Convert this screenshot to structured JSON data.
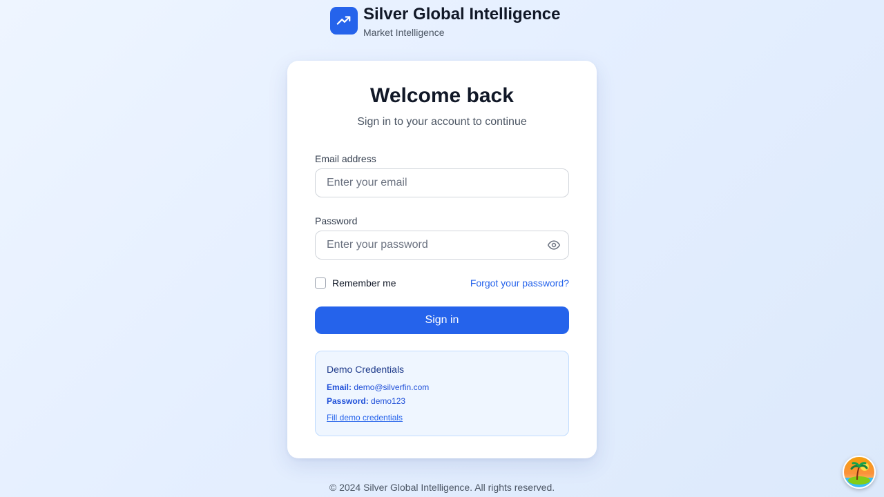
{
  "brand": {
    "title": "Silver Global Intelligence",
    "subtitle": "Market Intelligence",
    "logo_icon": "trending-up-icon",
    "logo_color": "#2563eb"
  },
  "login": {
    "heading": "Welcome back",
    "subheading": "Sign in to your account to continue",
    "email_label": "Email address",
    "email_placeholder": "Enter your email",
    "email_value": "",
    "password_label": "Password",
    "password_placeholder": "Enter your password",
    "password_value": "",
    "password_toggle_icon": "eye-icon",
    "remember_label": "Remember me",
    "remember_checked": false,
    "forgot_link": "Forgot your password?",
    "submit_label": "Sign in",
    "accent_color": "#2563eb"
  },
  "demo": {
    "title": "Demo Credentials",
    "email_key": "Email:",
    "email_value": "demo@silverfin.com",
    "password_key": "Password:",
    "password_value": "demo123",
    "fill_link": "Fill demo credentials"
  },
  "footer": {
    "text": "© 2024 Silver Global Intelligence. All rights reserved."
  },
  "floating_button": {
    "icon": "palm-island-avatar-icon"
  }
}
